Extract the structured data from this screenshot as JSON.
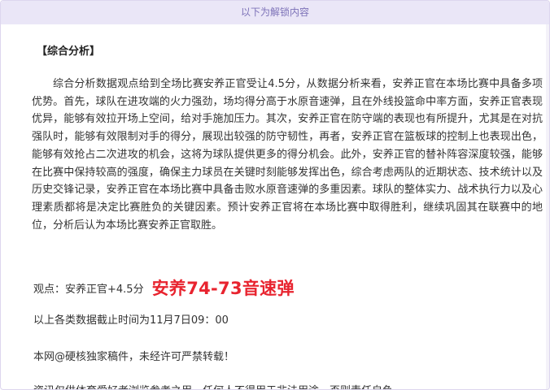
{
  "header": {
    "unlock_text": "以下为解锁内容"
  },
  "article": {
    "section_title": "【综合分析】",
    "analysis_paragraph": "综合分析数据观点给到全场比赛安养正官受让4.5分，从数据分析来看，安养正官在本场比赛中具备多项优势。首先，球队在进攻端的火力强劲，场均得分高于水原音速弹，且在外线投篮命中率方面，安养正官表现优异，能够有效拉开场上空间，给对手施加压力。其次，安养正官在防守端的表现也有所提升，尤其是在对抗强队时，能够有效限制对手的得分，展现出较强的防守韧性，再者，安养正官在篮板球的控制上也表现出色，能够有效抢占二次进攻的机会，这将为球队提供更多的得分机会。此外，安养正官的替补阵容深度较强，能够在比赛中保持较高的强度，确保主力球员在关键时刻能够发挥出色，综合考虑两队的近期状态、技术统计以及历史交锋记录，安养正官在本场比赛中具备击败水原音速弹的多重因素。球队的整体实力、战术执行力以及心理素质都将是决定比赛胜负的关键因素。预计安养正官将在本场比赛中取得胜利，继续巩固其在联赛中的地位，分析后认为本场比赛安养正官取胜。",
    "viewpoint_label": "观点：",
    "viewpoint_value": "安养正官+4.5分",
    "prediction": "安养74-73音速弹",
    "deadline": "以上各类数据截止时间为11月7日09：00",
    "copyright": "本网@硬核独家稿件，未经许可严禁转载！",
    "disclaimer": "资讯仅供体育爱好者浏览参考之用。任何人不得用于非法用途，否则责任自负。"
  },
  "colors": {
    "header_bg": "#eae6f7",
    "header_text": "#7d72b8",
    "prediction": "#e8242f",
    "body_text": "#333333"
  }
}
